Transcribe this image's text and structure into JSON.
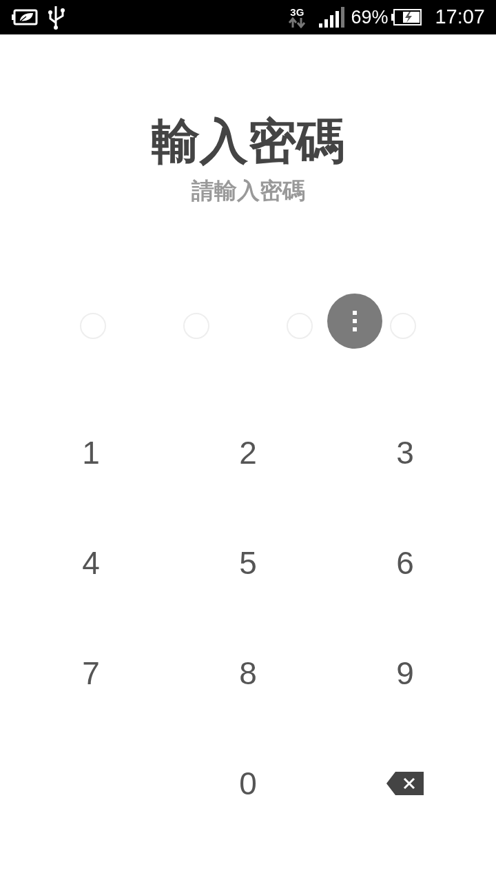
{
  "status_bar": {
    "network": "3G",
    "battery": "69%",
    "time": "17:07"
  },
  "title": "輸入密碼",
  "subtitle": "請輸入密碼",
  "pin_dots": [
    {
      "filled": false
    },
    {
      "filled": false
    },
    {
      "filled": false
    },
    {
      "filled": false
    }
  ],
  "keypad": [
    {
      "kind": "digit",
      "label": "1"
    },
    {
      "kind": "digit",
      "label": "2"
    },
    {
      "kind": "digit",
      "label": "3"
    },
    {
      "kind": "digit",
      "label": "4"
    },
    {
      "kind": "digit",
      "label": "5"
    },
    {
      "kind": "digit",
      "label": "6"
    },
    {
      "kind": "digit",
      "label": "7"
    },
    {
      "kind": "digit",
      "label": "8"
    },
    {
      "kind": "digit",
      "label": "9"
    },
    {
      "kind": "blank"
    },
    {
      "kind": "digit",
      "label": "0"
    },
    {
      "kind": "backspace"
    }
  ]
}
